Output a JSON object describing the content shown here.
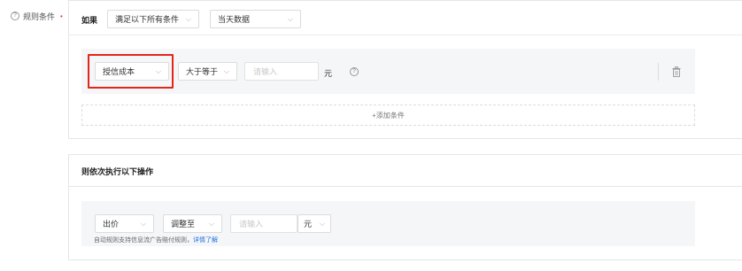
{
  "rule_label": {
    "help_glyph": "?",
    "text": "规则条件",
    "required_mark": "•"
  },
  "if_section": {
    "label": "如果",
    "match_select": {
      "value": "满足以下所有条件"
    },
    "data_select": {
      "value": "当天数据"
    }
  },
  "condition": {
    "metric_select": {
      "value": "授信成本"
    },
    "operator_select": {
      "value": "大于等于"
    },
    "value_input": {
      "placeholder": "请输入"
    },
    "unit": "元",
    "help_glyph": "?",
    "delete_icon": "trash-icon"
  },
  "add_condition_label": "+添加条件",
  "then_section": {
    "label": "则依次执行以下操作",
    "target_select": {
      "value": "出价"
    },
    "action_select": {
      "value": "调整至"
    },
    "value_input": {
      "placeholder": "请输入"
    },
    "unit_select": {
      "value": "元"
    },
    "note_text": "自动规则支持信息流广告赔付规则，",
    "note_link": "详情了解"
  },
  "colors": {
    "highlight": "#e5251b",
    "link": "#1f6fe5",
    "row_bg": "#f5f6f8"
  }
}
